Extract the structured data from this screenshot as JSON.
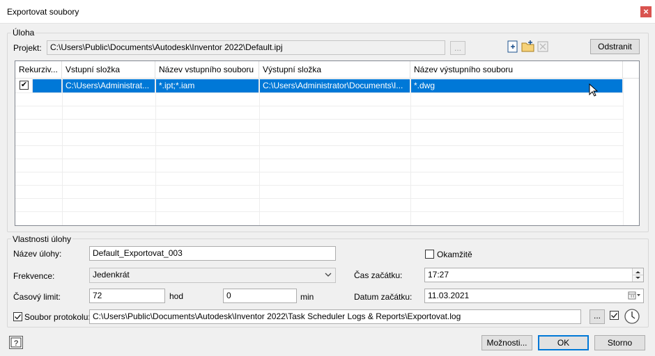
{
  "window": {
    "title": "Exportovat soubory",
    "close_symbol": "×"
  },
  "task_group": {
    "legend": "Úloha",
    "project_label": "Projekt:",
    "project_value": "C:\\Users\\Public\\Documents\\Autodesk\\Inventor 2022\\Default.ipj",
    "browse_label": "...",
    "remove_label": "Odstranit"
  },
  "grid": {
    "columns": [
      "Rekurziv...",
      "Vstupní složka",
      "Název vstupního souboru",
      "Výstupní složka",
      "Název výstupního souboru"
    ],
    "rows": [
      {
        "checked": "✔",
        "input_folder": "C:\\Users\\Administrat...",
        "input_file": "*.ipt;*.iam",
        "output_folder": "C:\\Users\\Administrator\\Documents\\I...",
        "output_file": "*.dwg"
      }
    ]
  },
  "props": {
    "legend": "Vlastnosti úlohy",
    "task_name_label": "Název úlohy:",
    "task_name_value": "Default_Exportovat_003",
    "immediate_label": "Okamžitě",
    "frequency_label": "Frekvence:",
    "frequency_value": "Jedenkrát",
    "start_time_label": "Čas začátku:",
    "start_time_value": "17:27",
    "time_limit_label": "Časový limit:",
    "time_limit_hours": "72",
    "hours_unit": "hod",
    "time_limit_minutes": "0",
    "minutes_unit": "min",
    "start_date_label": "Datum začátku:",
    "start_date_value": "11.03.2021",
    "log_label": "Soubor protokolu:",
    "log_value": "C:\\Users\\Public\\Documents\\Autodesk\\Inventor 2022\\Task Scheduler Logs & Reports\\Exportovat.log",
    "log_browse_label": "...",
    "log_checked": "✓"
  },
  "footer": {
    "help_symbol": "?",
    "options_label": "Možnosti...",
    "ok_label": "OK",
    "cancel_label": "Storno"
  }
}
